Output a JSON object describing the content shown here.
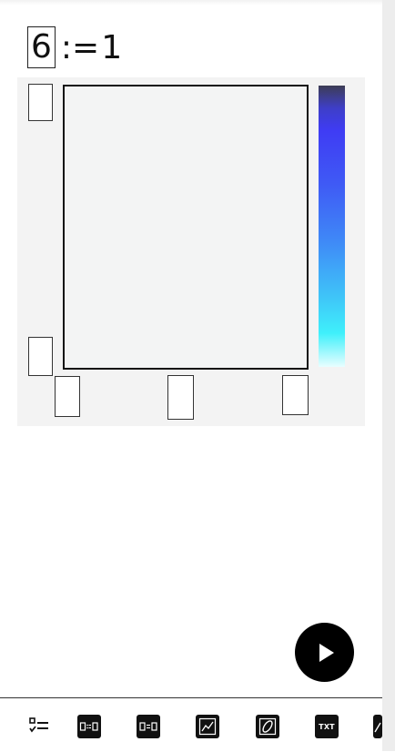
{
  "definition": {
    "variable": "6",
    "operator": ":=",
    "value": "1"
  },
  "plot": {
    "colorbar_colors": [
      "#3d3d55",
      "#3f3cf4",
      "#3f88f7",
      "#3ff0fb",
      "#e8feff"
    ]
  },
  "run_button": {
    "icon": "play-icon"
  },
  "toolbar": {
    "items": [
      {
        "name": "list-icon"
      },
      {
        "name": "define-icon"
      },
      {
        "name": "evaluate-icon"
      },
      {
        "name": "plot-icon"
      },
      {
        "name": "parametric-icon"
      },
      {
        "name": "text-icon",
        "label": "TXT"
      },
      {
        "name": "more-icon"
      }
    ]
  }
}
